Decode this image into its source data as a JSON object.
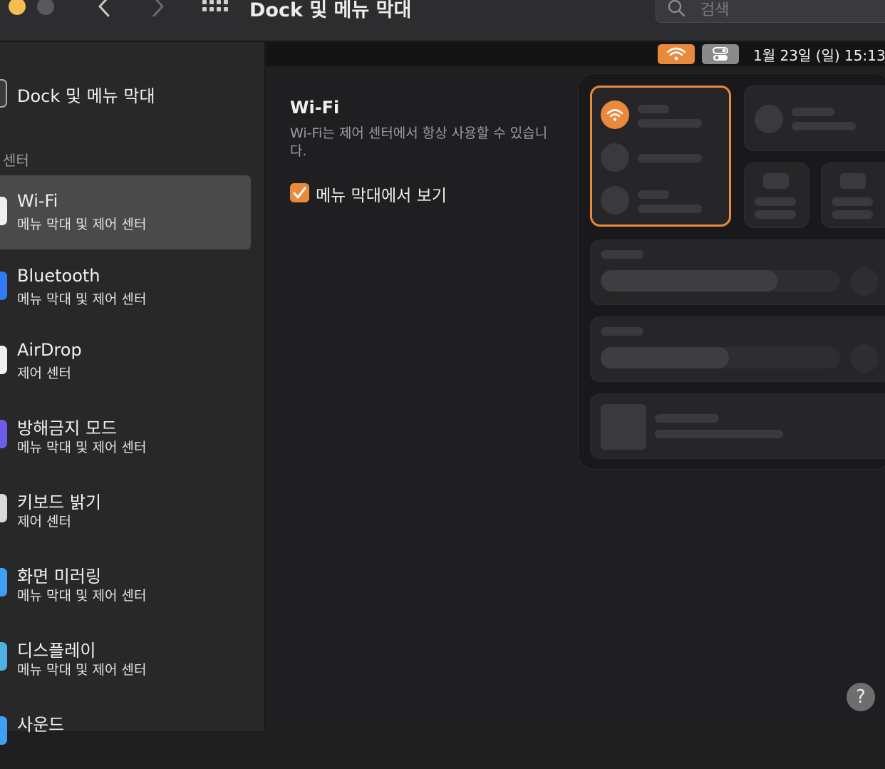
{
  "window": {
    "title": "Dock 및 메뉴 막대"
  },
  "search": {
    "placeholder": "검색"
  },
  "menubar": {
    "date_time": "1월 23일 (일)  15:13"
  },
  "sidebar": {
    "top_item": {
      "label": "Dock 및 메뉴 막대"
    },
    "section_label": "센터",
    "items": [
      {
        "label": "Wi-Fi",
        "sub": "메뉴 막대 및 제어 센터",
        "selected": true,
        "icon": "wifi-icon",
        "color": "#3b82f6"
      },
      {
        "label": "Bluetooth",
        "sub": "메뉴 막대 및 제어 센터",
        "icon": "bluetooth-icon",
        "color": "#2f7bf5"
      },
      {
        "label": "AirDrop",
        "sub": "제어 센터",
        "icon": "airdrop-icon",
        "color": "#4aa3f0"
      },
      {
        "label": "방해금지 모드",
        "sub": "메뉴 막대 및 제어 센터",
        "icon": "moon-icon",
        "color": "#6c5ce7"
      },
      {
        "label": "키보드 밝기",
        "sub": "제어 센터",
        "icon": "keyboard-brightness-icon",
        "color": "#d9d9d9"
      },
      {
        "label": "화면 미러링",
        "sub": "메뉴 막대 및 제어 센터",
        "icon": "screen-mirroring-icon",
        "color": "#3ea0f5"
      },
      {
        "label": "디스플레이",
        "sub": "메뉴 막대 및 제어 센터",
        "icon": "display-icon",
        "color": "#4fb0e6"
      },
      {
        "label": "사운드",
        "sub": "",
        "icon": "sound-icon",
        "color": "#3ea0f5"
      }
    ]
  },
  "detail": {
    "title": "Wi-Fi",
    "description": "Wi-Fi는 제어 센터에서 항상 사용할 수 있습니다.",
    "checkbox_label": "메뉴 막대에서 보기",
    "checkbox_checked": true
  },
  "help": {
    "label": "?"
  },
  "colors": {
    "accent": "#e9893b",
    "selection": "#4a4a4a"
  }
}
